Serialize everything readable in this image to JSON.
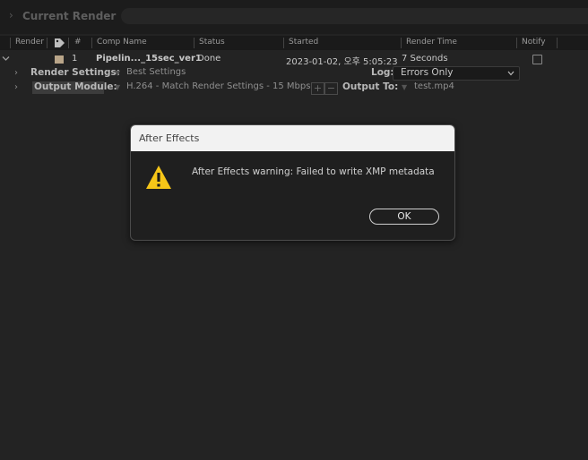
{
  "panel": {
    "title_chevron": "›",
    "title": "Current Render"
  },
  "columns": [
    "Render",
    "#",
    "Comp Name",
    "Status",
    "Started",
    "Render Time",
    "Notify"
  ],
  "queue_item": {
    "number": "1",
    "comp_name": "Pipelin..._15sec_ver1",
    "status": "Done",
    "started": "2023-01-02, 오후 5:05:23",
    "render_time": "7 Seconds",
    "label_color": "#b9a589"
  },
  "render_settings": {
    "label": "Render Settings:",
    "value": "Best Settings",
    "log_label": "Log:",
    "log_value": "Errors Only"
  },
  "output_module": {
    "label": "Output Module:",
    "value": "H.264 - Match Render Settings - 15 Mbps",
    "add": "+",
    "remove": "−",
    "output_to_label": "Output To:",
    "output_file": "test.mp4"
  },
  "dialog": {
    "title": "After Effects",
    "message": "After Effects warning: Failed to write XMP metadata",
    "ok_label": "OK",
    "icon": "warning-icon"
  }
}
